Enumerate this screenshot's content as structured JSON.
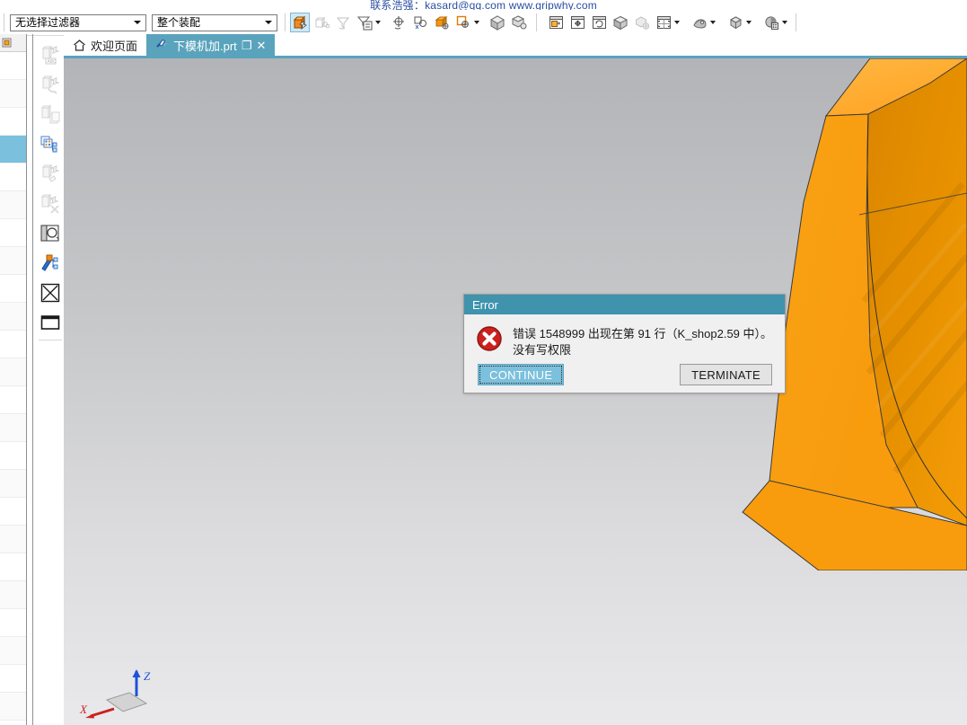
{
  "watermark": {
    "text": "联系浩强：kasard@qq.com  www.gripwhy.com"
  },
  "toolbar": {
    "selection_filter": {
      "value": "无选择过滤器",
      "icon": "chevron-down-icon"
    },
    "scope_filter": {
      "value": "整个装配",
      "icon": "chevron-down-icon"
    },
    "buttons": [
      {
        "name": "select-objects-icon",
        "label": ""
      },
      {
        "name": "select-linked-icon",
        "label": ""
      },
      {
        "name": "filter-undo-icon",
        "label": ""
      },
      {
        "name": "filter-list-icon",
        "label": ""
      },
      {
        "name": "move-object-icon",
        "label": ""
      },
      {
        "name": "object-display-icon",
        "label": ""
      },
      {
        "name": "show-hide-object-icon",
        "label": ""
      },
      {
        "name": "hide-target-icon",
        "label": ""
      },
      {
        "name": "fit-window-icon",
        "label": ""
      },
      {
        "name": "zoom-pan-icon",
        "label": ""
      },
      {
        "name": "rotate-view-icon",
        "label": ""
      },
      {
        "name": "shaded-render-icon",
        "label": ""
      },
      {
        "name": "render-settings-icon",
        "label": ""
      },
      {
        "name": "view-layout-icon",
        "label": ""
      },
      {
        "name": "view-orientation-icon",
        "label": ""
      },
      {
        "name": "shaded-style-icon",
        "label": ""
      },
      {
        "name": "visual-settings-icon",
        "label": ""
      }
    ]
  },
  "tabs": [
    {
      "label": "欢迎页面",
      "icon": "home-icon",
      "active": false,
      "closable": false
    },
    {
      "label": "下模机加.prt",
      "icon": "part-file-icon",
      "active": true,
      "closable": true,
      "close_label": "✕",
      "restore_label": "❐"
    }
  ],
  "left_panel": {
    "name": "resource-bar-list",
    "rows": 24,
    "selected_row_index": 3
  },
  "rail": {
    "items": [
      {
        "name": "annotation-tool-icon",
        "enabled": false
      },
      {
        "name": "feature-tool-icon",
        "enabled": false
      },
      {
        "name": "copy-feature-icon",
        "enabled": false
      },
      {
        "name": "pattern-feature-icon",
        "enabled": true
      },
      {
        "name": "edit-feature-icon",
        "enabled": false
      },
      {
        "name": "delete-feature-icon",
        "enabled": false
      },
      {
        "name": "sketch-region-icon",
        "enabled": true
      },
      {
        "name": "measure-tool-icon",
        "enabled": true
      },
      {
        "name": "cross-shape-icon",
        "enabled": true
      },
      {
        "name": "rectangle-shape-icon",
        "enabled": true
      }
    ]
  },
  "viewport": {
    "name": "graphics-window",
    "background_top": "#b3b4b7",
    "background_bottom": "#e9e9eb",
    "model_color": "#f79b0e",
    "model_shadow": "#cf8200",
    "model_highlight": "#ffb236",
    "triad": {
      "z_label": "Z",
      "x_label": "X",
      "z_color": "#1a54d8",
      "x_color": "#cc2020"
    }
  },
  "dialog": {
    "title": "Error",
    "title_bg": "#3f93ad",
    "icon": "error-circle-icon",
    "message_line1": "错误 1548999 出现在第 91 行（K_shop2.59 中）。",
    "message_line2": "没有写权限",
    "continue_label": "CONTINUE",
    "terminate_label": "TERMINATE",
    "accent": "#7bc0dc"
  }
}
